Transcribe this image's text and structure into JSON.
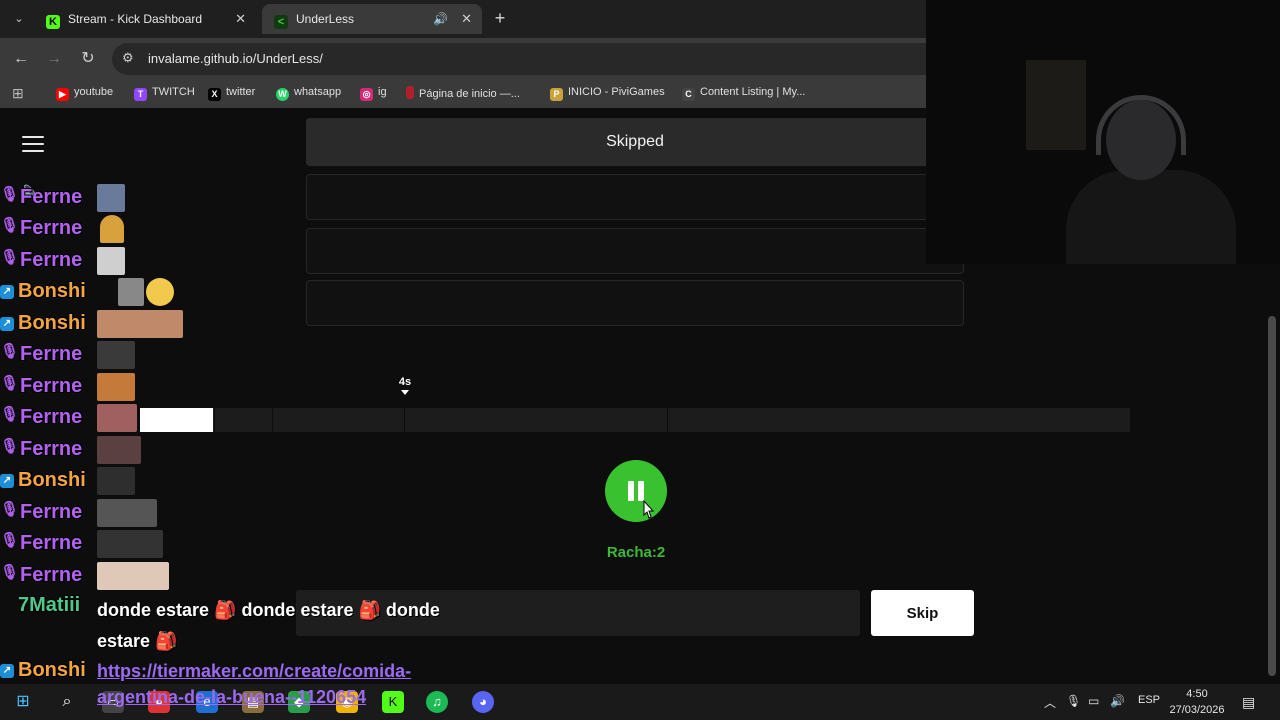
{
  "browser": {
    "tabs": [
      {
        "label": "Stream - Kick Dashboard",
        "favicon_color": "#53fc18",
        "favicon_glyph": "K"
      },
      {
        "label": "UnderLess",
        "favicon_color": "#1a3a1a",
        "favicon_glyph": "<"
      }
    ],
    "url": "invalame.github.io/UnderLess/",
    "bookmarks": [
      {
        "label": "youtube",
        "color": "#ff0000",
        "glyph": "▶"
      },
      {
        "label": "TWITCH",
        "color": "#9146ff",
        "glyph": "T"
      },
      {
        "label": "twitter",
        "color": "#000000",
        "glyph": "X"
      },
      {
        "label": "whatsapp",
        "color": "#25d366",
        "glyph": "W"
      },
      {
        "label": "ig",
        "color": "#d62976",
        "glyph": "◎"
      },
      {
        "label": "Página de inicio —...",
        "color": "#b0202a",
        "glyph": "N"
      },
      {
        "label": "INICIO - PiviGames",
        "color": "#c9a23a",
        "glyph": "P"
      },
      {
        "label": "Content Listing | My...",
        "color": "#555555",
        "glyph": "C"
      }
    ]
  },
  "game": {
    "skipped_label": "Skipped",
    "marker_label": "4s",
    "progress_fraction": 0.074,
    "streak_label": "Racha:2",
    "input_placeholder": "",
    "skip_label": "Skip",
    "accent_color": "#39c12f"
  },
  "chat": {
    "rows": [
      {
        "user": "Ferrne",
        "badge": "mic"
      },
      {
        "user": "Ferrne",
        "badge": "mic"
      },
      {
        "user": "Ferrne",
        "badge": "mic"
      },
      {
        "user": "Bonshi",
        "badge": "boost"
      },
      {
        "user": "Bonshi",
        "badge": "boost"
      },
      {
        "user": "Ferrne",
        "badge": "mic"
      },
      {
        "user": "Ferrne",
        "badge": "mic"
      },
      {
        "user": "Ferrne",
        "badge": "mic"
      },
      {
        "user": "Ferrne",
        "badge": "mic"
      },
      {
        "user": "Bonshi",
        "badge": "boost"
      },
      {
        "user": "Ferrne",
        "badge": "mic"
      },
      {
        "user": "Ferrne",
        "badge": "mic"
      },
      {
        "user": "Ferrne",
        "badge": "mic"
      }
    ],
    "matiii_user": "7Matiii",
    "matiii_message_line1": "donde estare 🎒 donde estare 🎒 donde",
    "matiii_message_line2": "estare 🎒",
    "bonshi_last_user": "Bonshi",
    "bonshi_link_line1": "https://tiermaker.com/create/comida-",
    "bonshi_link_line2": "argentina-de-la-buena--1120654"
  },
  "taskbar": {
    "language": "ESP",
    "time": "4:50",
    "date": "27/03/2026"
  }
}
